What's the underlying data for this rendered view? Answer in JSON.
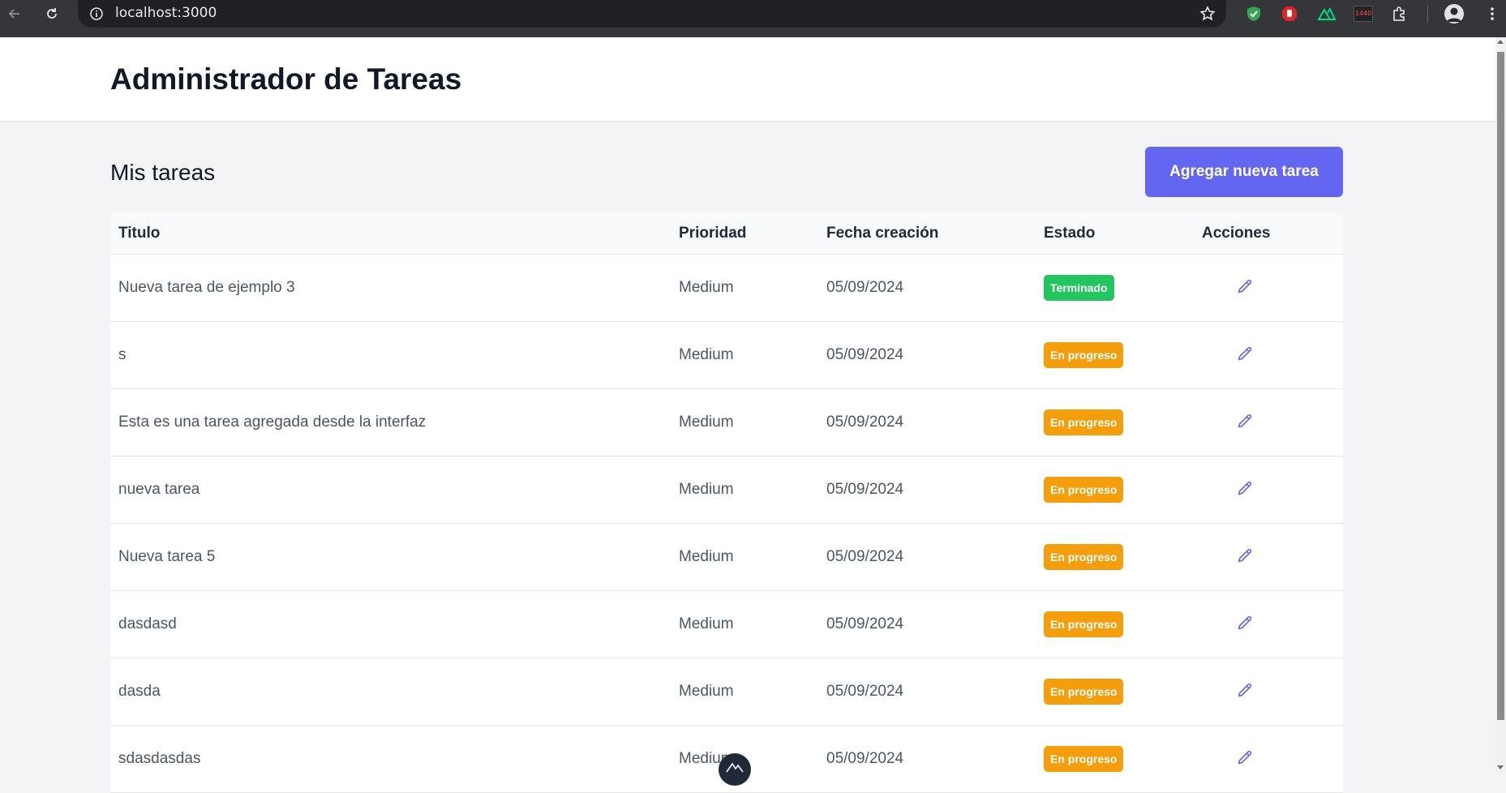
{
  "browser": {
    "url": "localhost:3000",
    "icons": [
      "back-icon",
      "reload-icon",
      "info-icon",
      "star-icon",
      "shield-extension-icon",
      "adblock-extension-icon",
      "nuxt-extension-icon",
      "resolution-extension-icon",
      "puzzle-icon",
      "profile-avatar",
      "kebab-menu-icon"
    ],
    "resolution_badge": "1440"
  },
  "header": {
    "title": "Administrador de Tareas"
  },
  "main": {
    "section_title": "Mis tareas",
    "add_button_label": "Agregar nueva tarea"
  },
  "table": {
    "columns": [
      "Titulo",
      "Prioridad",
      "Fecha creación",
      "Estado",
      "Acciones"
    ],
    "rows": [
      {
        "title": "Nueva tarea de ejemplo 3",
        "priority": "Medium",
        "date": "05/09/2024",
        "status": "Terminado",
        "status_color": "#22c55e"
      },
      {
        "title": "s",
        "priority": "Medium",
        "date": "05/09/2024",
        "status": "En progreso",
        "status_color": "#f59e0b"
      },
      {
        "title": "Esta es una tarea agregada desde la interfaz",
        "priority": "Medium",
        "date": "05/09/2024",
        "status": "En progreso",
        "status_color": "#f59e0b"
      },
      {
        "title": "nueva tarea",
        "priority": "Medium",
        "date": "05/09/2024",
        "status": "En progreso",
        "status_color": "#f59e0b"
      },
      {
        "title": "Nueva tarea 5",
        "priority": "Medium",
        "date": "05/09/2024",
        "status": "En progreso",
        "status_color": "#f59e0b"
      },
      {
        "title": "dasdasd",
        "priority": "Medium",
        "date": "05/09/2024",
        "status": "En progreso",
        "status_color": "#f59e0b"
      },
      {
        "title": "dasda",
        "priority": "Medium",
        "date": "05/09/2024",
        "status": "En progreso",
        "status_color": "#f59e0b"
      },
      {
        "title": "sdasdasdas",
        "priority": "Medium",
        "date": "05/09/2024",
        "status": "En progreso",
        "status_color": "#f59e0b"
      }
    ]
  },
  "colors": {
    "accent": "#6366f1",
    "status_done": "#22c55e",
    "status_in_progress": "#f59e0b"
  }
}
